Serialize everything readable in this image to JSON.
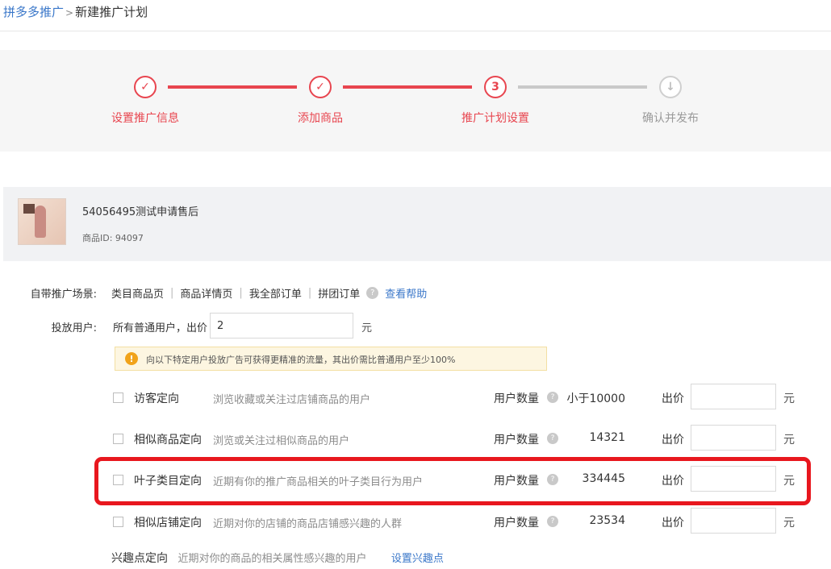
{
  "breadcrumb": {
    "parent": "拼多多推广",
    "separator": ">",
    "current": "新建推广计划"
  },
  "steps": [
    {
      "label": "设置推广信息",
      "symbol": "✓",
      "status": "done"
    },
    {
      "label": "添加商品",
      "symbol": "✓",
      "status": "done"
    },
    {
      "label": "推广计划设置",
      "symbol": "3",
      "status": "active"
    },
    {
      "label": "确认并发布",
      "symbol": "↓",
      "status": "pending"
    }
  ],
  "product": {
    "title": "54056495测试申请售后",
    "id_text": "商品ID: 94097"
  },
  "resources": {
    "label": "自带推广场景:",
    "items": [
      "类目商品页",
      "商品详情页",
      "我全部订单",
      "拼团订单"
    ],
    "help_icon": "?",
    "link": "查看帮助"
  },
  "base_bid": {
    "label": "投放用户:",
    "prefix": "所有普通用户，出价",
    "value": "2",
    "unit": "元"
  },
  "warning": {
    "icon": "!",
    "text": "向以下特定用户投放广告可获得更精准的流量，其出价需比普通用户至少100%"
  },
  "targets": [
    {
      "name": "访客定向",
      "desc": "浏览收藏或关注过店铺商品的用户",
      "count_label": "用户数量",
      "count": "小于10000",
      "bid_label": "出价",
      "bid": "",
      "unit": "元"
    },
    {
      "name": "相似商品定向",
      "desc": "浏览或关注过相似商品的用户",
      "count_label": "用户数量",
      "count": "14321",
      "bid_label": "出价",
      "bid": "",
      "unit": "元"
    },
    {
      "name": "叶子类目定向",
      "desc": "近期有你的推广商品相关的叶子类目行为用户",
      "count_label": "用户数量",
      "count": "334445",
      "bid_label": "出价",
      "bid": "",
      "unit": "元"
    },
    {
      "name": "相似店铺定向",
      "desc": "近期对你的店铺的商品店铺感兴趣的人群",
      "count_label": "用户数量",
      "count": "23534",
      "bid_label": "出价",
      "bid": "",
      "unit": "元"
    }
  ],
  "interest": {
    "name": "兴趣点定向",
    "desc": "近期对你的商品的相关属性感兴趣的用户",
    "link": "设置兴趣点"
  },
  "colors": {
    "accent": "#e8454f",
    "highlight": "#e8171e",
    "link": "#3a77c9"
  }
}
